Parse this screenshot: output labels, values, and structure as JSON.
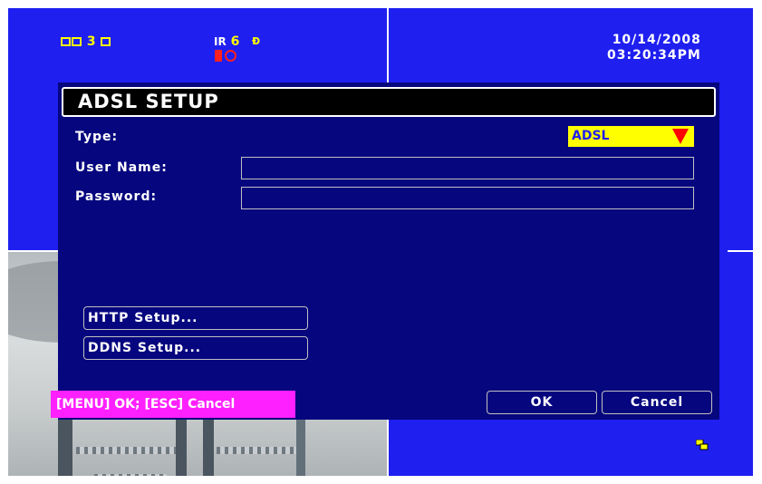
{
  "status": {
    "camera_number": "3",
    "ir_label": "IR",
    "ir_value": "6"
  },
  "datetime": {
    "date": "10/14/2008",
    "time": "03:20:34PM"
  },
  "dialog": {
    "title": "ADSL SETUP",
    "type_label": "Type:",
    "type_value": "ADSL",
    "username_label": "User Name:",
    "username_value": "",
    "password_label": "Password:",
    "password_value": "",
    "http_button": "HTTP Setup...",
    "ddns_button": "DDNS Setup...",
    "ok_button": "OK",
    "cancel_button": "Cancel"
  },
  "hint": "[MENU] OK; [ESC] Cancel",
  "colors": {
    "screen_bg": "#1f1ff0",
    "dialog_bg": "#06067f",
    "dropdown_bg": "#ffff00",
    "hint_bg": "#ff20ff",
    "dropdown_arrow": "#ff0000"
  },
  "icons": [
    "camera-channel-icon",
    "record-icon",
    "timer-icon",
    "motion-alarm-icon",
    "network-icon",
    "dropdown-arrow-icon"
  ]
}
